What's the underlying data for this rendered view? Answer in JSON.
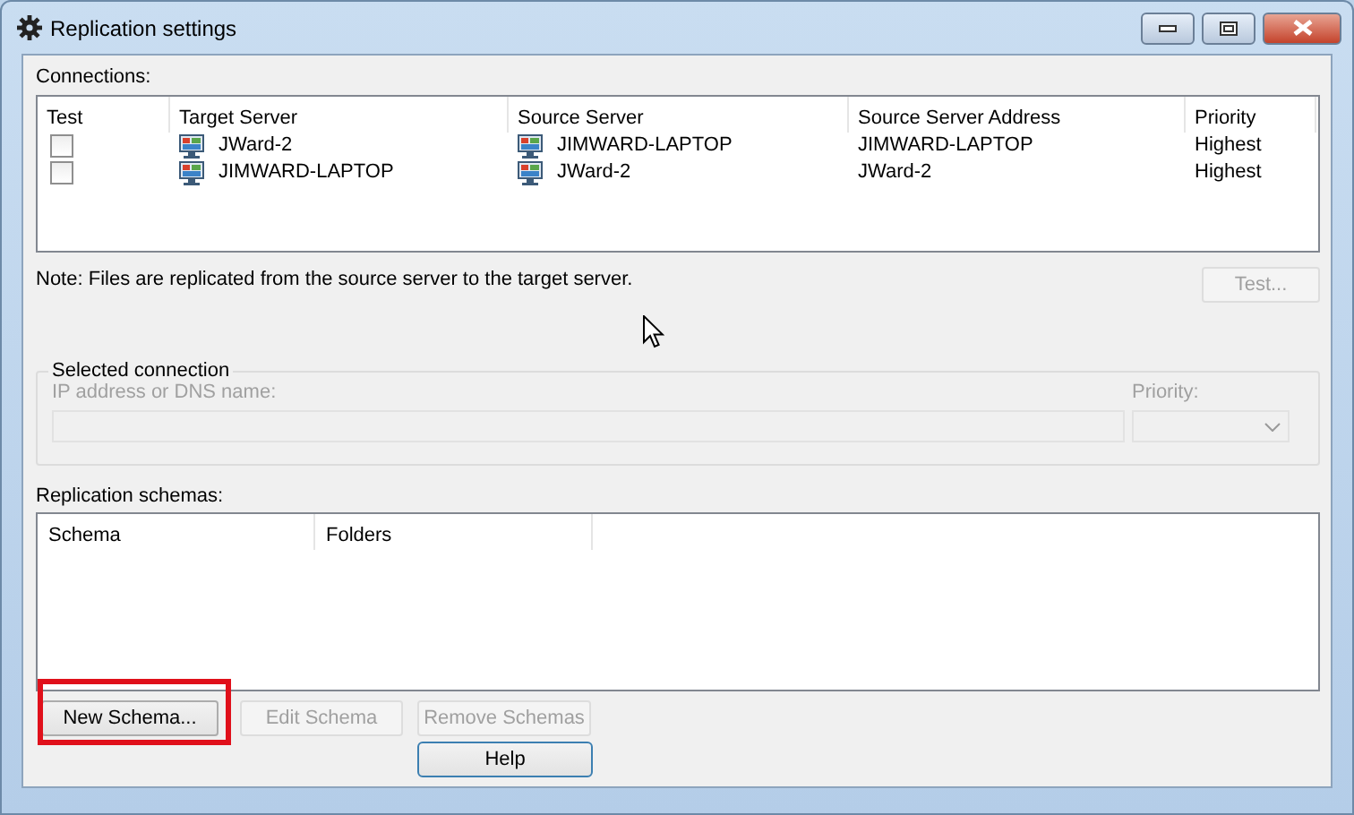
{
  "window": {
    "title": "Replication settings"
  },
  "connections": {
    "label": "Connections:",
    "columns": [
      "Test",
      "Target Server",
      "Source Server",
      "Source Server Address",
      "Priority"
    ],
    "rows": [
      {
        "test_checked": false,
        "target_server": "JWard-2",
        "source_server": "JIMWARD-LAPTOP",
        "source_server_address": "JIMWARD-LAPTOP",
        "priority": "Highest"
      },
      {
        "test_checked": false,
        "target_server": "JIMWARD-LAPTOP",
        "source_server": "JWard-2",
        "source_server_address": "JWard-2",
        "priority": "Highest"
      }
    ]
  },
  "note": "Note: Files are replicated from the source server to the target server.",
  "test_button": {
    "label": "Test...",
    "disabled": true
  },
  "selected_connection": {
    "title": "Selected connection",
    "address_label": "IP address or DNS name:",
    "priority_label": "Priority:",
    "disabled": true
  },
  "schemas": {
    "label": "Replication schemas:",
    "columns": [
      "Schema",
      "Folders"
    ]
  },
  "buttons": [
    {
      "label": "New Schema...",
      "disabled": false,
      "highlighted": true
    },
    {
      "label": "Edit Schema",
      "disabled": true,
      "highlighted": false
    },
    {
      "label": "Remove Schemas",
      "disabled": true,
      "highlighted": false
    }
  ],
  "help_button": {
    "label": "Help",
    "disabled": false
  }
}
